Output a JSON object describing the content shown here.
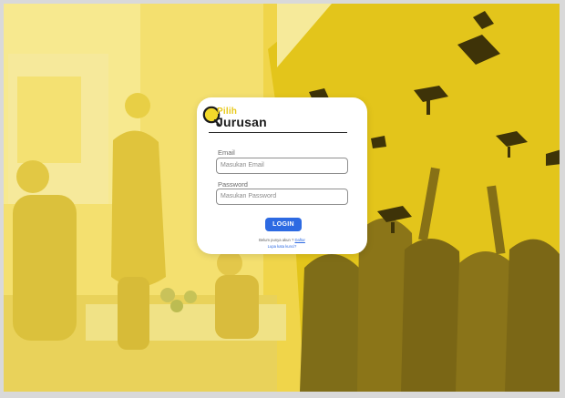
{
  "brand": {
    "top": "Pilih",
    "bottom": "Jurusan"
  },
  "form": {
    "email_label": "Email",
    "email_placeholder": "Masukan Email",
    "password_label": "Password",
    "password_placeholder": "Masukan Password",
    "login_label": "LOGIN"
  },
  "footer": {
    "signup_prompt": "Belum punya akun ?",
    "signup_link": "Daftar",
    "forgot_link": "Lupa kata kunci?"
  },
  "colors": {
    "accent_yellow": "#f1d64c",
    "button_blue": "#2d6ae2"
  }
}
